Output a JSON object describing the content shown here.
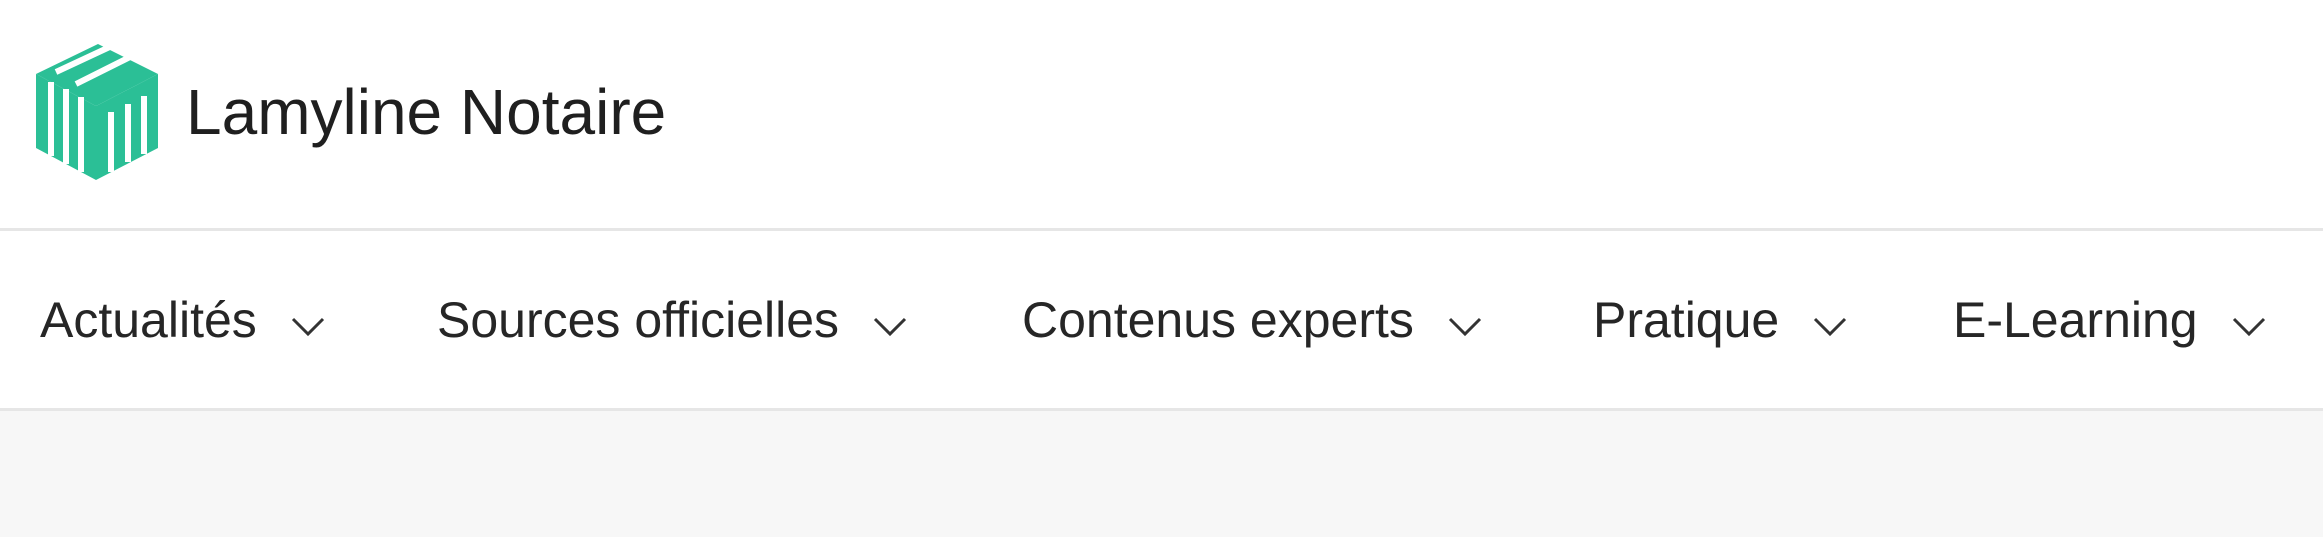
{
  "brand": {
    "name": "Lamyline Notaire",
    "logo_icon": "lamyline-logo-icon",
    "accent_color": "#2bbf96"
  },
  "nav": {
    "items": [
      {
        "label": "Actualités",
        "icon": "chevron-down-icon"
      },
      {
        "label": "Sources officielles",
        "icon": "chevron-down-icon"
      },
      {
        "label": "Contenus experts",
        "icon": "chevron-down-icon"
      },
      {
        "label": "Pratique",
        "icon": "chevron-down-icon"
      },
      {
        "label": "E-Learning",
        "icon": "chevron-down-icon"
      }
    ]
  }
}
